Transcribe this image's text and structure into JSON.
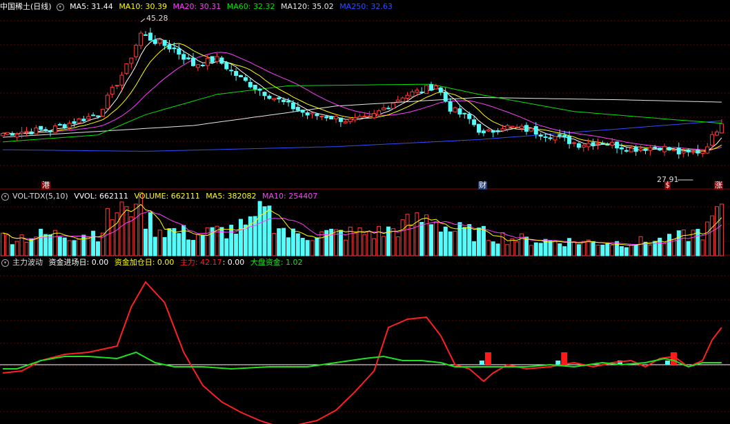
{
  "colors": {
    "up": "#ff3c3c",
    "down": "#54fcfc",
    "ma5": "#ffffff",
    "ma10": "#ffff00",
    "ma20": "#ff40ff",
    "ma60": "#00e600",
    "ma120": "#e8e8e8",
    "ma250": "#2f4fff",
    "grid": "#6b0000",
    "zhuli": "#ff2020",
    "dapan": "#20e020",
    "zero_line": "#ffffff"
  },
  "price_panel": {
    "title": "中国稀土(日线)",
    "indicators": [
      {
        "label": "MA5: 31.44",
        "color": "#ffffff"
      },
      {
        "label": "MA10: 30.39",
        "color": "#ffff00"
      },
      {
        "label": "MA20: 30.31",
        "color": "#ff40ff"
      },
      {
        "label": "MA60: 32.32",
        "color": "#00e600"
      },
      {
        "label": "MA120: 35.02",
        "color": "#e8e8e8"
      },
      {
        "label": "MA250: 32.63",
        "color": "#2f4fff"
      }
    ],
    "high_label": "45.28",
    "low_label": "27.91",
    "event_tags": [
      {
        "text": "港",
        "style": "red"
      },
      {
        "text": "财",
        "style": "blue"
      },
      {
        "text": "$",
        "style": "red"
      },
      {
        "text": "涨",
        "style": "red"
      }
    ]
  },
  "volume_panel": {
    "title": "VOL-TDX(5,10)",
    "indicators": [
      {
        "label": "VVOL: 662111",
        "color": "#ffffff"
      },
      {
        "label": "VOLUME: 662111",
        "color": "#ffff00"
      },
      {
        "label": "MA5: 382082",
        "color": "#ffff00"
      },
      {
        "label": "MA10: 254407",
        "color": "#ff40ff"
      }
    ]
  },
  "flow_panel": {
    "title": "主力波动",
    "indicators": [
      {
        "label": "资金进场日: 0.00",
        "color": "#ffffff"
      },
      {
        "label": "资金加仓日: 0.00",
        "color": "#ffff00"
      },
      {
        "label": "主力: 42.17",
        "color": "#ff2020"
      },
      {
        "label": ": 0.00",
        "color": "#ffffff"
      },
      {
        "label": "大盘资金: 1.02",
        "color": "#20e020"
      }
    ]
  },
  "chart_data": [
    {
      "type": "candlestick",
      "title": "中国稀土(日线)",
      "ma_labels": [
        "MA5",
        "MA10",
        "MA20",
        "MA60",
        "MA120",
        "MA250"
      ],
      "ma_values": [
        31.44,
        30.39,
        30.31,
        32.32,
        35.02,
        32.63
      ],
      "annotations": [
        "45.28",
        "27.91"
      ],
      "anchors": [
        {
          "bar": 0,
          "close": 31.0
        },
        {
          "bar": 10,
          "close": 31.5
        },
        {
          "bar": 20,
          "close": 33.5
        },
        {
          "bar": 26,
          "close": 39.5
        },
        {
          "bar": 29,
          "close": 43.8
        },
        {
          "bar": 32,
          "close": 42.8
        },
        {
          "bar": 36,
          "close": 41.8
        },
        {
          "bar": 40,
          "close": 39.8
        },
        {
          "bar": 45,
          "close": 40.5
        },
        {
          "bar": 50,
          "close": 38.0
        },
        {
          "bar": 55,
          "close": 36.2
        },
        {
          "bar": 60,
          "close": 34.6
        },
        {
          "bar": 64,
          "close": 33.4
        },
        {
          "bar": 68,
          "close": 33.2
        },
        {
          "bar": 73,
          "close": 32.6
        },
        {
          "bar": 77,
          "close": 32.9
        },
        {
          "bar": 80,
          "close": 34.2
        },
        {
          "bar": 84,
          "close": 35.8
        },
        {
          "bar": 88,
          "close": 36.5
        },
        {
          "bar": 91,
          "close": 37.2
        },
        {
          "bar": 94,
          "close": 34.2
        },
        {
          "bar": 98,
          "close": 32.8
        },
        {
          "bar": 101,
          "close": 30.8
        },
        {
          "bar": 105,
          "close": 31.9
        },
        {
          "bar": 110,
          "close": 31.5
        },
        {
          "bar": 116,
          "close": 30.6
        },
        {
          "bar": 121,
          "close": 29.6
        },
        {
          "bar": 126,
          "close": 29.9
        },
        {
          "bar": 132,
          "close": 29.0
        },
        {
          "bar": 138,
          "close": 29.3
        },
        {
          "bar": 143,
          "close": 28.3
        },
        {
          "bar": 147,
          "close": 28.8
        },
        {
          "bar": 149,
          "close": 30.5
        },
        {
          "bar": 151,
          "close": 32.6
        }
      ]
    },
    {
      "type": "bar",
      "title": "VOL-TDX(5,10)",
      "series": [
        {
          "name": "VVOL",
          "values": [
            662111
          ]
        },
        {
          "name": "MA5",
          "values": [
            382082
          ]
        },
        {
          "name": "MA10",
          "values": [
            254407
          ]
        }
      ]
    },
    {
      "type": "line",
      "title": "主力波动",
      "series": [
        {
          "name": "主力",
          "last": 42.17,
          "anchors": [
            [
              0,
              -4
            ],
            [
              4,
              -3
            ],
            [
              8,
              2
            ],
            [
              13,
              5
            ],
            [
              18,
              6
            ],
            [
              24,
              9
            ],
            [
              27,
              28
            ],
            [
              30,
              40
            ],
            [
              34,
              30
            ],
            [
              38,
              6
            ],
            [
              42,
              -10
            ],
            [
              46,
              -18
            ],
            [
              50,
              -23
            ],
            [
              54,
              -27
            ],
            [
              58,
              -30
            ],
            [
              62,
              -29
            ],
            [
              66,
              -27
            ],
            [
              70,
              -22
            ],
            [
              74,
              -13
            ],
            [
              78,
              -3
            ],
            [
              81,
              18
            ],
            [
              85,
              22
            ],
            [
              89,
              23
            ],
            [
              92,
              14
            ],
            [
              95,
              0
            ],
            [
              98,
              -2
            ],
            [
              101,
              -8
            ],
            [
              103,
              -4
            ],
            [
              106,
              0
            ],
            [
              110,
              -2
            ],
            [
              115,
              -1
            ],
            [
              120,
              1
            ],
            [
              124,
              -1
            ],
            [
              128,
              1
            ],
            [
              132,
              2
            ],
            [
              135,
              -1
            ],
            [
              138,
              3
            ],
            [
              141,
              4
            ],
            [
              144,
              -1
            ],
            [
              147,
              2
            ],
            [
              149,
              12
            ],
            [
              151,
              18
            ]
          ]
        },
        {
          "name": "大盘资金",
          "last": 1.02,
          "anchors": [
            [
              0,
              -2
            ],
            [
              3,
              -2
            ],
            [
              8,
              2
            ],
            [
              13,
              4
            ],
            [
              18,
              4
            ],
            [
              24,
              3
            ],
            [
              28,
              6
            ],
            [
              32,
              1
            ],
            [
              36,
              -1
            ],
            [
              42,
              -1
            ],
            [
              48,
              -2
            ],
            [
              56,
              -1
            ],
            [
              64,
              -1
            ],
            [
              70,
              1
            ],
            [
              76,
              3
            ],
            [
              80,
              4
            ],
            [
              84,
              2
            ],
            [
              88,
              2
            ],
            [
              92,
              1
            ],
            [
              95,
              -1
            ],
            [
              99,
              -1
            ],
            [
              104,
              -1
            ],
            [
              110,
              -1
            ],
            [
              115,
              0
            ],
            [
              120,
              -1
            ],
            [
              126,
              1
            ],
            [
              130,
              0
            ],
            [
              135,
              1
            ],
            [
              139,
              3
            ],
            [
              141,
              2
            ],
            [
              144,
              -1
            ],
            [
              147,
              1
            ],
            [
              151,
              1
            ]
          ]
        }
      ],
      "signals": [
        {
          "bar": 101,
          "cyan": 2,
          "red": 6
        },
        {
          "bar": 117,
          "cyan": 2,
          "red": 6
        },
        {
          "bar": 130,
          "cyan": 2,
          "red": 0
        },
        {
          "bar": 140,
          "cyan": 2,
          "red": 6
        }
      ]
    }
  ]
}
